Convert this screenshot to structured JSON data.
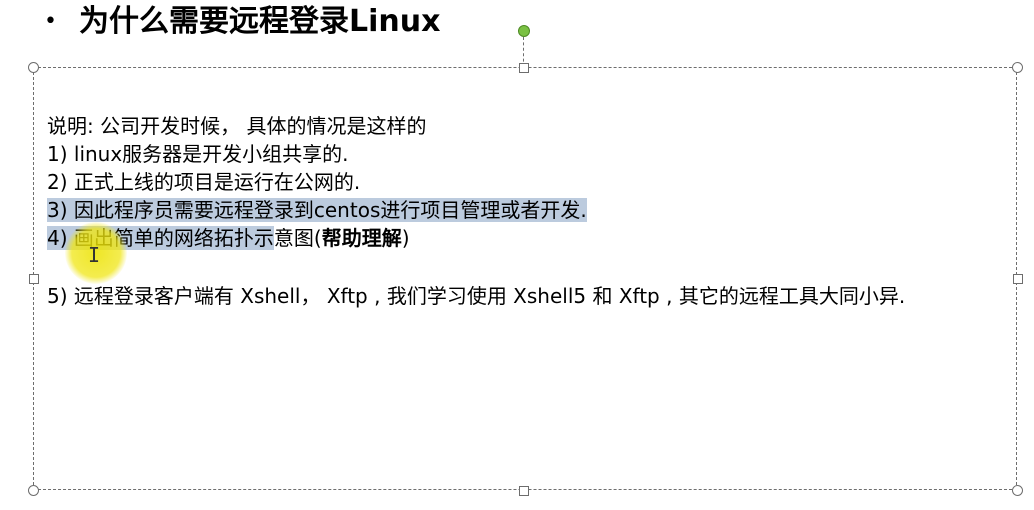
{
  "slide": {
    "bullet_symbol": "•",
    "title": "为什么需要远程登录Linux",
    "lines": [
      "说明: 公司开发时候， 具体的情况是这样的",
      "1) linux服务器是开发小组共享的.",
      "2) 正式上线的项目是运行在公网的.",
      "3) 因此程序员需要远程登录到centos进行项目管理或者开发.",
      "4) 画出简单的网络拓扑示",
      "意图(",
      "帮助理解",
      ")"
    ],
    "line5": " 5) 远程登录客户端有 Xshell， Xftp , 我们学习使用 Xshell5 和 Xftp , 其它的远程工具大同小异."
  },
  "colors": {
    "selection_highlight": "#bccbde",
    "laser_pointer": "#ece200",
    "rotate_handle": "#7ac143",
    "frame_border": "#6d6d6d"
  },
  "icons": {
    "cursor": "i-beam-cursor-icon",
    "rotate": "rotate-handle-icon"
  }
}
